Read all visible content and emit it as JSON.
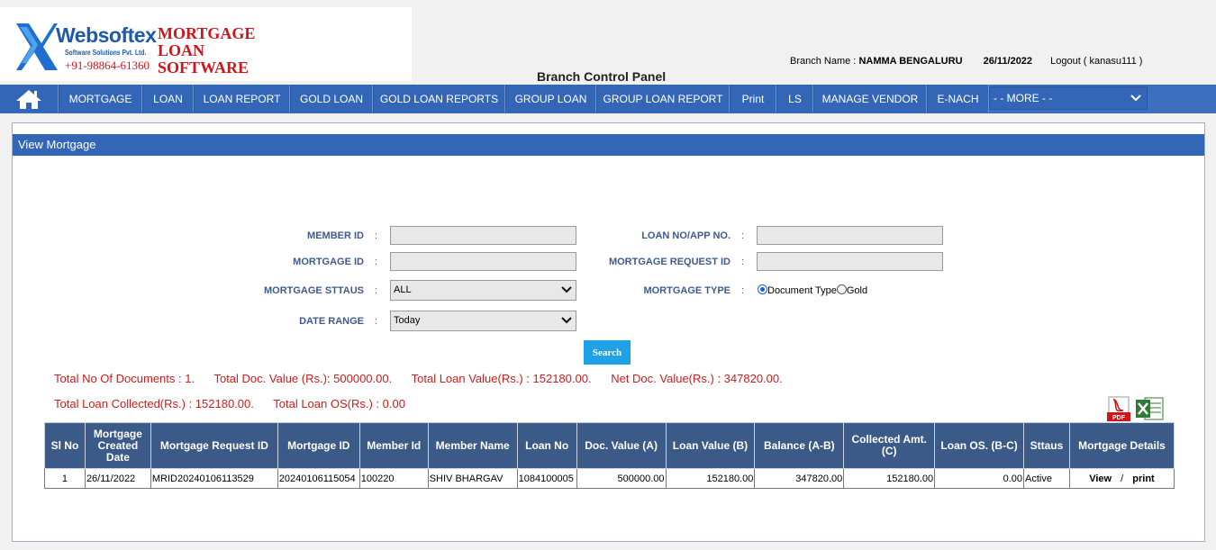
{
  "brand": {
    "name": "Websoftex",
    "subtitle": "Software Solutions Pvt. Ltd.",
    "phone": "+91-98864-61360",
    "title_lines": [
      "MORTGAGE",
      "LOAN",
      "SOFTWARE"
    ]
  },
  "header": {
    "branch_label": "Branch Name :",
    "branch_value": "NAMMA BENGALURU",
    "date": "26/11/2022",
    "logout": "Logout ( kanasu111 )",
    "panel_title": "Branch Control Panel"
  },
  "nav": {
    "items": [
      "MORTGAGE",
      "LOAN",
      "LOAN REPORT",
      "GOLD LOAN",
      "GOLD LOAN REPORTS",
      "GROUP LOAN",
      "GROUP LOAN REPORT",
      "Print",
      "LS",
      "MANAGE VENDOR",
      "E-NACH"
    ],
    "more": "- - MORE - -"
  },
  "panel": {
    "title": "View Mortgage"
  },
  "form": {
    "member_id_label": "MEMBER ID",
    "loan_no_label": "LOAN NO/APP NO.",
    "mortgage_id_label": "MORTGAGE ID",
    "mortgage_request_id_label": "MORTGAGE REQUEST ID",
    "mortgage_status_label": "MORTGAGE STTAUS",
    "mortgage_status_value": "ALL",
    "mortgage_type_label": "MORTGAGE TYPE",
    "type_option_1": "Document Type",
    "type_option_2": "Gold",
    "date_range_label": "DATE RANGE",
    "date_range_value": "Today",
    "colon": ":",
    "search_label": "Search"
  },
  "summary": {
    "total_docs": "Total No Of Documents : 1.",
    "total_doc_value": "Total Doc. Value (Rs.): 500000.00.",
    "total_loan_value": "Total Loan Value(Rs.) : 152180.00.",
    "net_doc_value": "Net Doc. Value(Rs.) : 347820.00.",
    "total_loan_collected": "Total Loan Collected(Rs.) : 152180.00.",
    "total_loan_os": "Total Loan OS(Rs.) : 0.00"
  },
  "table": {
    "headers": [
      "Sl No",
      "Mortgage Created Date",
      "Mortgage Request ID",
      "Mortgage ID",
      "Member Id",
      "Member Name",
      "Loan No",
      "Doc. Value (A)",
      "Loan Value (B)",
      "Balance (A-B)",
      "Collected Amt. (C)",
      "Loan OS. (B-C)",
      "Sttaus",
      "Mortgage Details"
    ],
    "rows": [
      {
        "sl": "1",
        "created": "26/11/2022",
        "request_id": "MRID20240106113529",
        "mortgage_id": "20240106115054",
        "member_id": "100220",
        "member_name": "SHIV BHARGAV",
        "loan_no": "1084100005",
        "doc_value": "500000.00",
        "loan_value": "152180.00",
        "balance": "347820.00",
        "collected": "152180.00",
        "loan_os": "0.00",
        "status": "Active",
        "view": "View",
        "sep": "/",
        "print": "print"
      }
    ]
  },
  "icons": {
    "home": "home-icon",
    "pdf": "pdf-icon",
    "excel": "excel-icon"
  }
}
